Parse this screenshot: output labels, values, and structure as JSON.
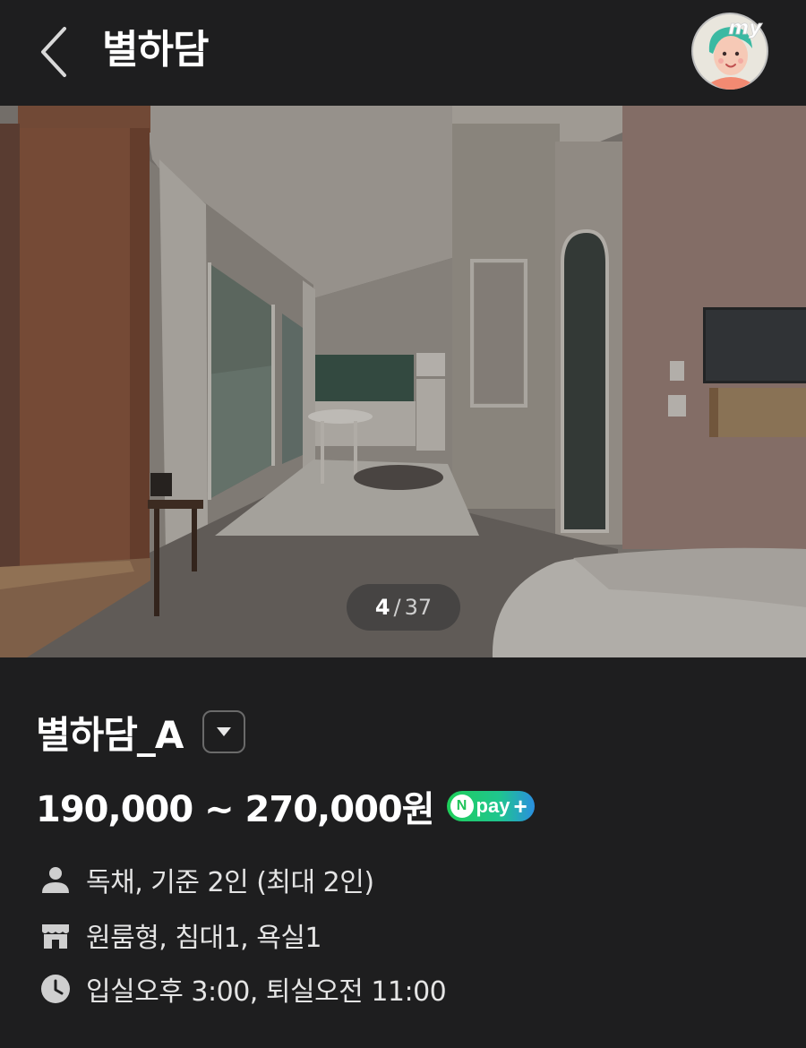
{
  "header": {
    "title": "별하담",
    "avatar_badge": "my"
  },
  "gallery": {
    "current": "4",
    "separator": "/",
    "total": "37"
  },
  "room": {
    "name": "별하담_A",
    "price": "190,000 ~ 270,000원",
    "npay": {
      "n": "N",
      "label": "pay",
      "plus": "+"
    }
  },
  "details": [
    {
      "icon": "person-icon",
      "text": "독채, 기준 2인 (최대 2인)"
    },
    {
      "icon": "store-icon",
      "text": "원룸형, 침대1, 욕실1"
    },
    {
      "icon": "clock-icon",
      "text": "입실오후 3:00, 퇴실오전 11:00"
    }
  ],
  "colors": {
    "background": "#1e1e1f",
    "text": "#ffffff",
    "npay_green": "#1fcf5a",
    "npay_blue": "#2a8fe0"
  }
}
